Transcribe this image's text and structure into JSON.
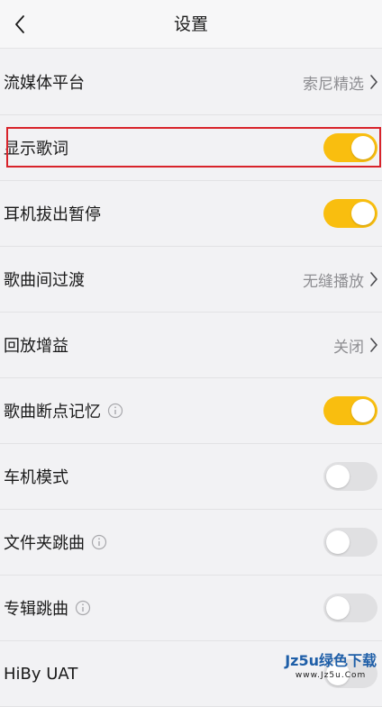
{
  "header": {
    "title": "设置"
  },
  "rows": [
    {
      "label": "流媒体平台",
      "type": "nav",
      "value": "索尼精选"
    },
    {
      "label": "显示歌词",
      "type": "toggle",
      "on": true
    },
    {
      "label": "耳机拔出暂停",
      "type": "toggle",
      "on": true
    },
    {
      "label": "歌曲间过渡",
      "type": "nav",
      "value": "无缝播放"
    },
    {
      "label": "回放增益",
      "type": "nav",
      "value": "关闭"
    },
    {
      "label": "歌曲断点记忆",
      "type": "toggle",
      "on": true,
      "info": true
    },
    {
      "label": "车机模式",
      "type": "toggle",
      "on": false
    },
    {
      "label": "文件夹跳曲",
      "type": "toggle",
      "on": false,
      "info": true
    },
    {
      "label": "专辑跳曲",
      "type": "toggle",
      "on": false,
      "info": true
    },
    {
      "label": "HiBy UAT",
      "type": "toggle",
      "on": false
    }
  ],
  "watermark": {
    "brand": "Jz5u绿色下载",
    "site": "www.Jz5u.Com"
  },
  "colors": {
    "toggle_on": "#f9be0f",
    "toggle_off": "#e0e0e2",
    "highlight": "#d8232a",
    "background": "#f2f2f4"
  },
  "icons": {
    "back": "chevron-left-icon",
    "nav": "chevron-right-icon",
    "info": "info-icon"
  }
}
